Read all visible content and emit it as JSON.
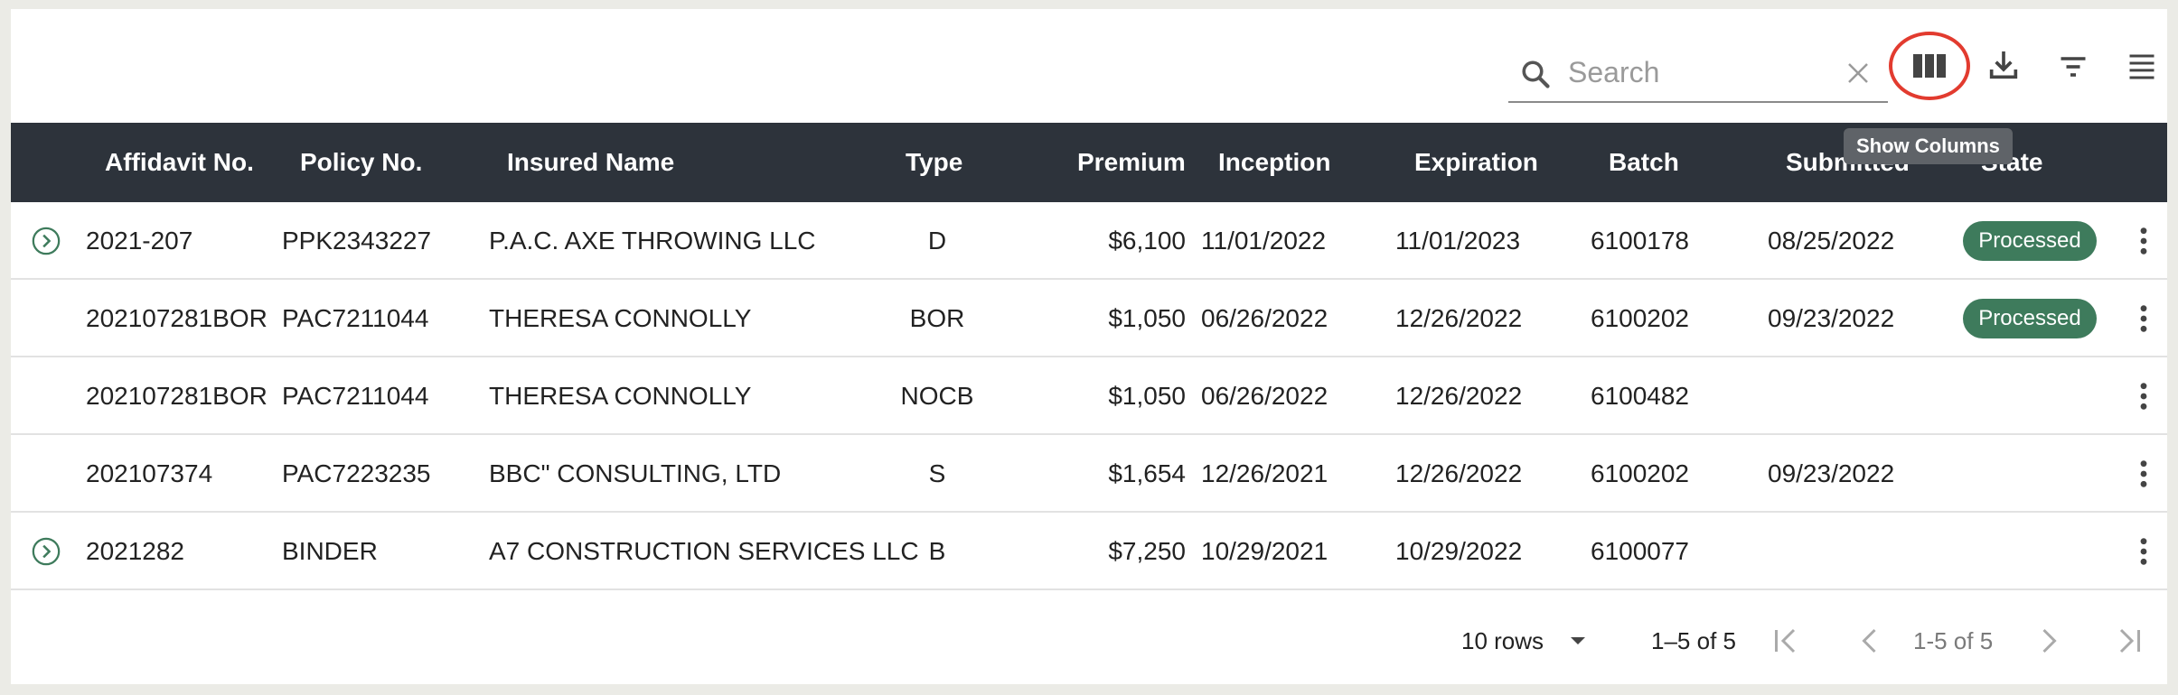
{
  "toolbar": {
    "search_placeholder": "Search",
    "search_value": "",
    "tooltip": "Show Columns"
  },
  "columns": [
    "Affidavit No.",
    "Policy No.",
    "Insured Name",
    "Type",
    "Premium",
    "Inception",
    "Expiration",
    "Batch",
    "Submitted",
    "State"
  ],
  "rows": [
    {
      "expandable": true,
      "affidavit": "2021-207",
      "policy": "PPK2343227",
      "insured": "P.A.C. AXE THROWING LLC",
      "type": "D",
      "premium": "$6,100",
      "inception": "11/01/2022",
      "expiration": "11/01/2023",
      "batch": "6100178",
      "submitted": "08/25/2022",
      "state": "Processed"
    },
    {
      "expandable": false,
      "affidavit": "202107281BOR",
      "policy": "PAC7211044",
      "insured": "THERESA CONNOLLY",
      "type": "BOR",
      "premium": "$1,050",
      "inception": "06/26/2022",
      "expiration": "12/26/2022",
      "batch": "6100202",
      "submitted": "09/23/2022",
      "state": "Processed"
    },
    {
      "expandable": false,
      "affidavit": "202107281BOR",
      "policy": "PAC7211044",
      "insured": "THERESA CONNOLLY",
      "type": "NOCB",
      "premium": "$1,050",
      "inception": "06/26/2022",
      "expiration": "12/26/2022",
      "batch": "6100482",
      "submitted": "",
      "state": ""
    },
    {
      "expandable": false,
      "affidavit": "202107374",
      "policy": "PAC7223235",
      "insured": "BBC\" CONSULTING, LTD",
      "type": "S",
      "premium": "$1,654",
      "inception": "12/26/2021",
      "expiration": "12/26/2022",
      "batch": "6100202",
      "submitted": "09/23/2022",
      "state": ""
    },
    {
      "expandable": true,
      "affidavit": "2021282",
      "policy": "BINDER",
      "insured": "A7 CONSTRUCTION SERVICES LLC",
      "type": "B",
      "premium": "$7,250",
      "inception": "10/29/2021",
      "expiration": "10/29/2022",
      "batch": "6100077",
      "submitted": "",
      "state": ""
    }
  ],
  "footer": {
    "rows_per_page": "10 rows",
    "range": "1–5 of 5",
    "page": "1-5 of 5"
  },
  "colors": {
    "header_bg": "#2d333b",
    "badge_green": "#3e7b5c",
    "highlight_ring": "#e23b2f"
  }
}
